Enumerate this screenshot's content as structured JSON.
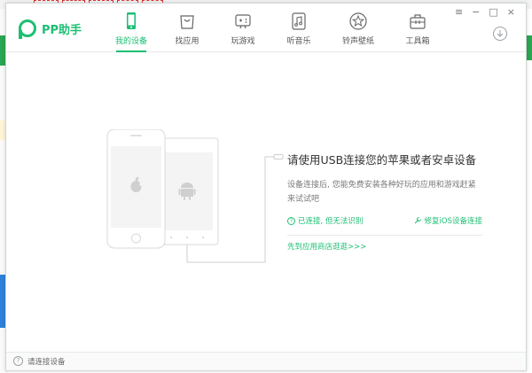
{
  "app": {
    "name": "PP助手"
  },
  "nav": {
    "items": [
      {
        "label": "我的设备",
        "icon": "phone-icon",
        "active": true
      },
      {
        "label": "找应用",
        "icon": "app-store-icon",
        "active": false
      },
      {
        "label": "玩游戏",
        "icon": "gamepad-icon",
        "active": false
      },
      {
        "label": "听音乐",
        "icon": "music-icon",
        "active": false
      },
      {
        "label": "铃声壁纸",
        "icon": "ringtone-wallpaper-icon",
        "active": false
      },
      {
        "label": "工具箱",
        "icon": "toolbox-icon",
        "active": false
      }
    ]
  },
  "window_controls": {
    "menu": "≡",
    "minimize": "−",
    "maximize": "□",
    "close": "×"
  },
  "main": {
    "title": "请使用USB连接您的苹果或者安卓设备",
    "description": "设备连接后, 您能免费安装各种好玩的应用和游戏赶紧来试试吧",
    "connected_unrecognized": "已连接, 但无法识别",
    "repair_ios": "修复iOS设备连接",
    "store_link": "先到应用商店逛逛>>>"
  },
  "status": {
    "text": "请连接设备"
  },
  "colors": {
    "accent": "#1dbf73",
    "border": "#d9d9d9",
    "device_fill": "#f4f4f4"
  }
}
